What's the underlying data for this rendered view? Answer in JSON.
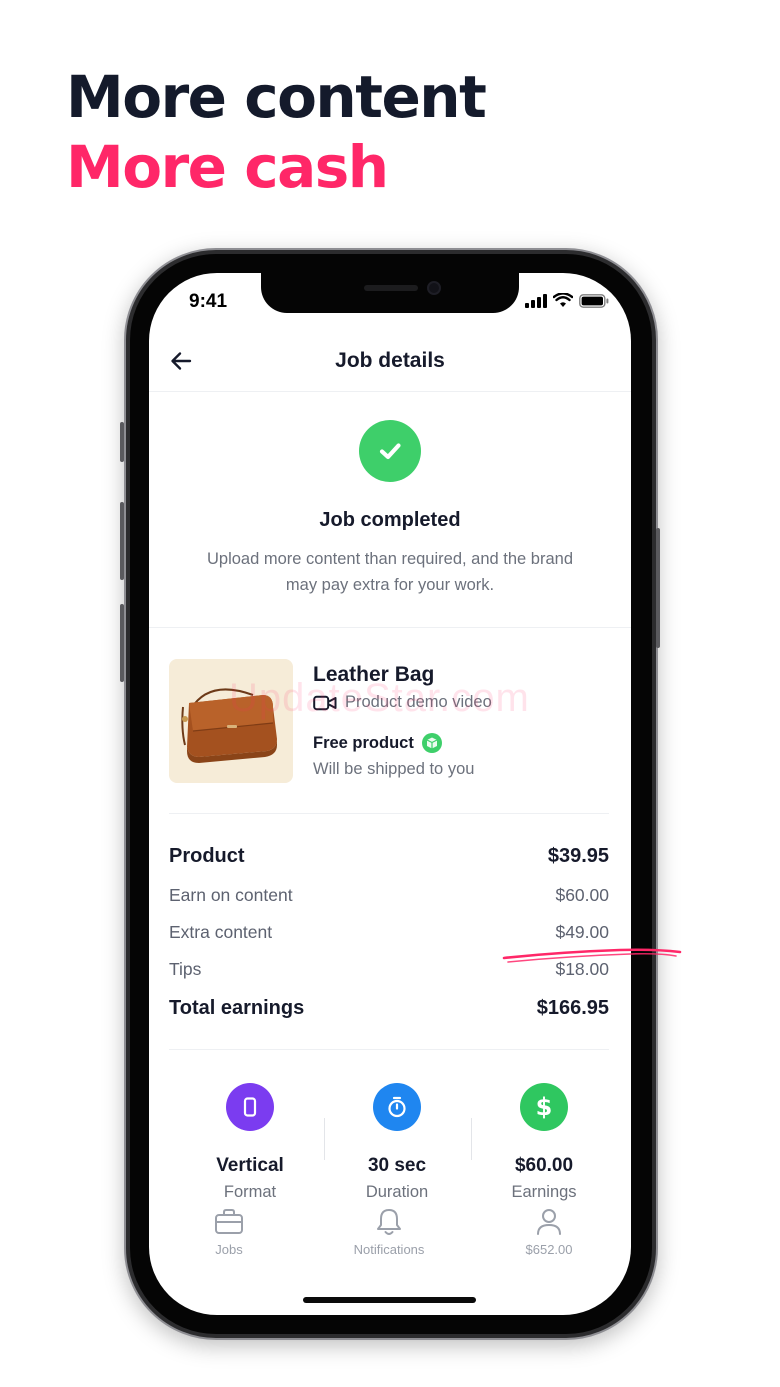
{
  "headline": {
    "line1": "More content",
    "line2": "More cash"
  },
  "colors": {
    "brand_pink": "#ff2768",
    "success_green": "#3ecf6a",
    "format_purple": "#7b3cf0",
    "duration_blue": "#1f86f0",
    "earnings_green": "#2fc760"
  },
  "status_bar": {
    "time": "9:41",
    "icons": [
      "cellular-signal-icon",
      "wifi-icon",
      "battery-icon"
    ]
  },
  "nav": {
    "title": "Job details",
    "back_icon": "arrow-left-icon"
  },
  "job_status": {
    "title": "Job completed",
    "description": "Upload more content than required, and the brand may pay extra for your work.",
    "icon": "check-icon"
  },
  "product": {
    "name": "Leather Bag",
    "type": "Product demo video",
    "type_icon": "video-camera-icon",
    "free_label": "Free product",
    "free_icon": "package-icon",
    "ship_note": "Will be shipped to you",
    "watermark": "UpdateStar.com"
  },
  "pricing": {
    "product": {
      "label": "Product",
      "value": "$39.95"
    },
    "earn_on_content": {
      "label": "Earn on content",
      "value": "$60.00"
    },
    "extra_content": {
      "label": "Extra content",
      "value": "$49.00"
    },
    "tips": {
      "label": "Tips",
      "value": "$18.00"
    },
    "total": {
      "label": "Total earnings",
      "value": "$166.95"
    }
  },
  "stats": [
    {
      "value": "Vertical",
      "label": "Format",
      "icon": "phone-portrait-icon"
    },
    {
      "value": "30 sec",
      "label": "Duration",
      "icon": "stopwatch-icon"
    },
    {
      "value": "$60.00",
      "label": "Earnings",
      "icon": "dollar-icon"
    }
  ],
  "tabs": [
    {
      "label": "Jobs",
      "icon": "briefcase-icon"
    },
    {
      "label": "Notifications",
      "icon": "bell-icon"
    },
    {
      "label": "$652.00",
      "icon": "user-icon"
    }
  ]
}
